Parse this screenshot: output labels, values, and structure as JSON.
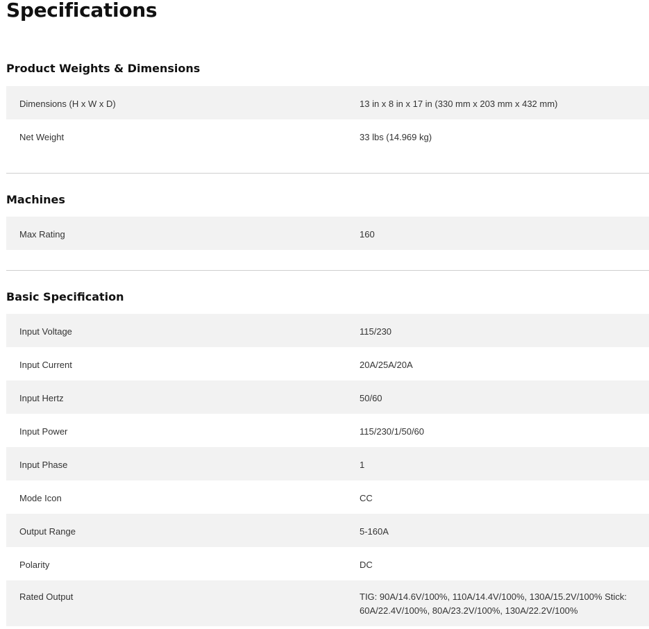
{
  "page_title": "Specifications",
  "sections": {
    "weights": {
      "title": "Product Weights & Dimensions",
      "rows": [
        {
          "label": "Dimensions (H x W x D)",
          "value": "13 in x 8 in x 17 in (330 mm x 203 mm x 432 mm)"
        },
        {
          "label": "Net Weight",
          "value": "33 lbs (14.969 kg)"
        }
      ]
    },
    "machines": {
      "title": "Machines",
      "rows": [
        {
          "label": "Max Rating",
          "value": "160"
        }
      ]
    },
    "basic": {
      "title": "Basic Specification",
      "rows": [
        {
          "label": "Input Voltage",
          "value": "115/230"
        },
        {
          "label": "Input Current",
          "value": "20A/25A/20A"
        },
        {
          "label": "Input Hertz",
          "value": "50/60"
        },
        {
          "label": "Input Power",
          "value": "115/230/1/50/60"
        },
        {
          "label": "Input Phase",
          "value": "1"
        },
        {
          "label": "Mode Icon",
          "value": "CC"
        },
        {
          "label": "Output Range",
          "value": "5-160A"
        },
        {
          "label": "Polarity",
          "value": "DC"
        },
        {
          "label": "Rated Output",
          "value": "TIG: 90A/14.6V/100%, 110A/14.4V/100%, 130A/15.2V/100% Stick: 60A/22.4V/100%, 80A/23.2V/100%, 130A/22.2V/100%"
        }
      ]
    }
  },
  "colors": {
    "row_shade": "#f2f2f2",
    "divider": "#cfcfcf",
    "heading": "#111111",
    "text": "#333333"
  }
}
